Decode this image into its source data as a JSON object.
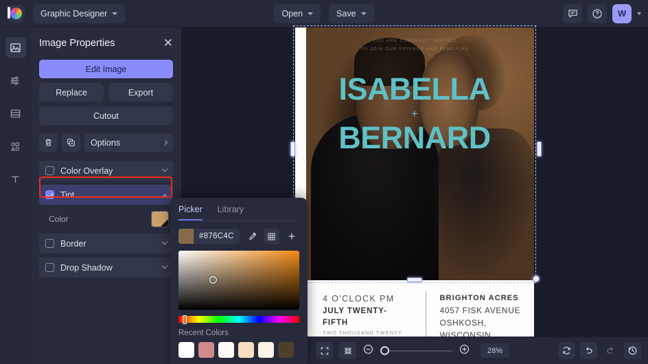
{
  "topbar": {
    "logo": "befunky-logo",
    "project_label": "Graphic Designer",
    "open_label": "Open",
    "save_label": "Save",
    "chat_icon": "chat-icon",
    "help_icon": "help-icon",
    "avatar_initial": "W"
  },
  "rail": {
    "items": [
      {
        "icon": "image-icon",
        "name": "image"
      },
      {
        "icon": "sliders-icon",
        "name": "adjustments"
      },
      {
        "icon": "layers-icon",
        "name": "templates"
      },
      {
        "icon": "shapes-icon",
        "name": "graphics"
      },
      {
        "icon": "text-icon",
        "name": "text"
      }
    ]
  },
  "panel": {
    "title": "Image Properties",
    "close_icon": "close-icon",
    "edit_image": "Edit Image",
    "replace": "Replace",
    "export": "Export",
    "cutout": "Cutout",
    "delete_icon": "trash-icon",
    "duplicate_icon": "duplicate-icon",
    "options_label": "Options",
    "properties": [
      {
        "label": "Color Overlay",
        "checked": false,
        "expanded": false,
        "highlighted": false
      },
      {
        "label": "Tint",
        "checked": true,
        "expanded": true,
        "highlighted": true
      },
      {
        "label": "Border",
        "checked": false,
        "expanded": false,
        "highlighted": false
      },
      {
        "label": "Drop Shadow",
        "checked": false,
        "expanded": false,
        "highlighted": false
      }
    ],
    "color_sub_label": "Color",
    "tint_color": "#c9a268"
  },
  "picker": {
    "tabs": [
      {
        "label": "Picker",
        "active": true
      },
      {
        "label": "Library",
        "active": false
      }
    ],
    "hex": "#876C4C",
    "eyedropper_icon": "eyedropper-icon",
    "grid_icon": "grid-icon",
    "add_icon": "plus-icon",
    "recent_label": "Recent Colors",
    "recent_colors": [
      "#ffffff",
      "#cf8a8a",
      "#fdfaf8",
      "#fadcc0",
      "#fdf3e7",
      "#4e3f2c"
    ]
  },
  "artwork": {
    "top_line1": "YOU ARE CORDIALLY INVITED",
    "top_line2": "TO JOIN OUR FRIENDS AND FAMILY AS",
    "name1": "ISABELLA",
    "amp": "+",
    "name2": "BERNARD",
    "time": "4 O'CLOCK PM",
    "date": "JULY TWENTY-FIFTH",
    "year": "TWO THOUSAND TWENTY ONE",
    "venue": "BRIGHTON ACRES",
    "street": "4057 FISK AVENUE",
    "city": "OSHKOSH, WISCONSIN",
    "name_color": "#5fc0c6"
  },
  "bottombar": {
    "fit_icon": "fit-screen-icon",
    "shrink_icon": "shrink-icon",
    "zoom_out_icon": "zoom-out-icon",
    "zoom_in_icon": "zoom-in-icon",
    "zoom_value": "28%",
    "reset_icon": "reset-icon",
    "undo_icon": "undo-icon",
    "redo_icon": "redo-icon",
    "history_icon": "history-icon"
  }
}
